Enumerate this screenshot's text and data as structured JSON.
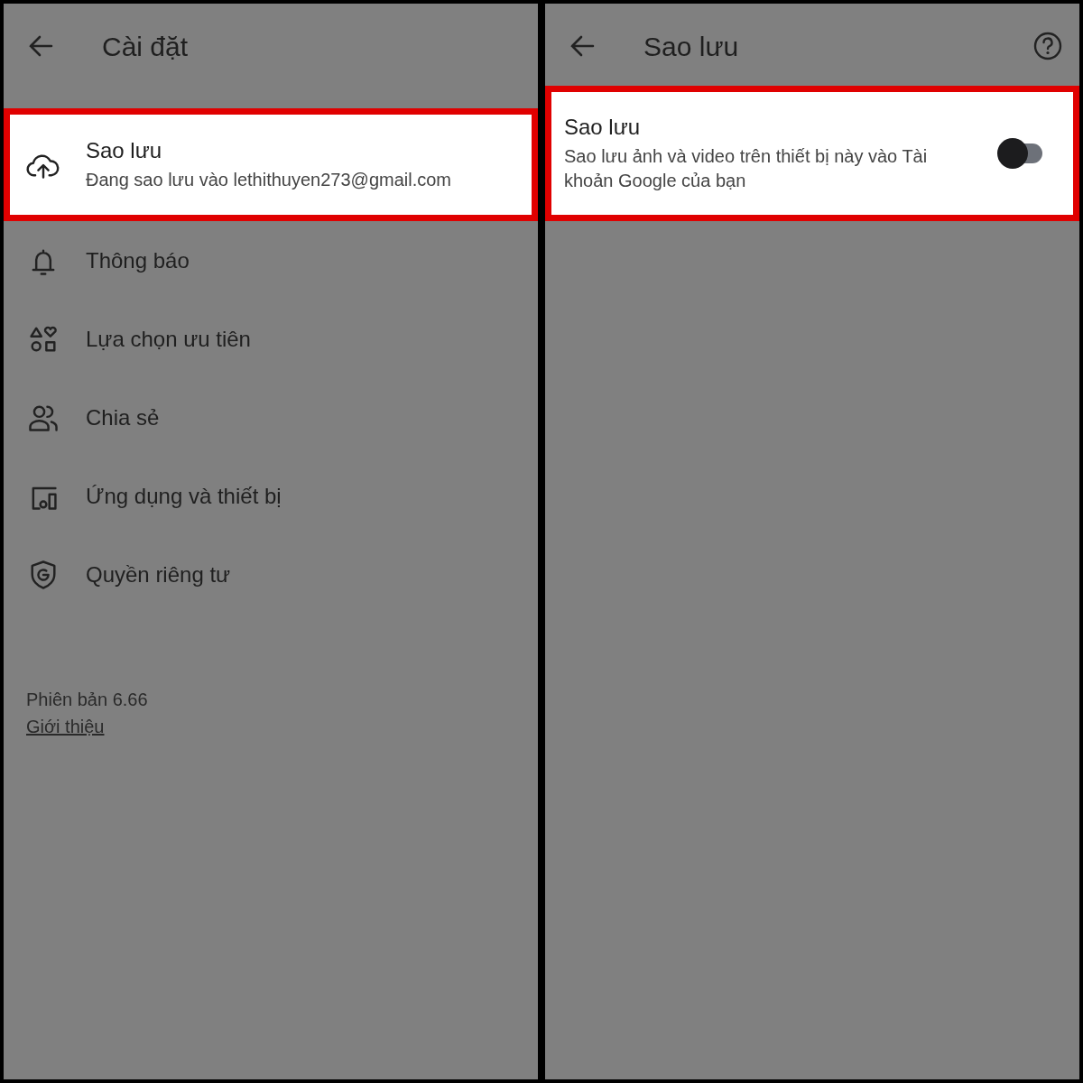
{
  "settings_screen": {
    "title": "Cài đặt",
    "items": [
      {
        "title": "Sao lưu",
        "subtitle": "Đang sao lưu vào lethithuyen273@gmail.com",
        "highlighted": true
      },
      {
        "title": "Thông báo",
        "highlighted": false
      },
      {
        "title": "Lựa chọn ưu tiên",
        "highlighted": false
      },
      {
        "title": "Chia sẻ",
        "highlighted": false
      },
      {
        "title": "Ứng dụng và thiết bị",
        "highlighted": false
      },
      {
        "title": "Quyền riêng tư",
        "highlighted": false
      }
    ],
    "version": "Phiên bản 6.66",
    "about_link": "Giới thiệu"
  },
  "backup_screen": {
    "title": "Sao lưu",
    "setting": {
      "title": "Sao lưu",
      "description": "Sao lưu ảnh và video trên thiết bị này vào Tài khoản Google của bạn",
      "on": false,
      "highlighted": true
    }
  }
}
